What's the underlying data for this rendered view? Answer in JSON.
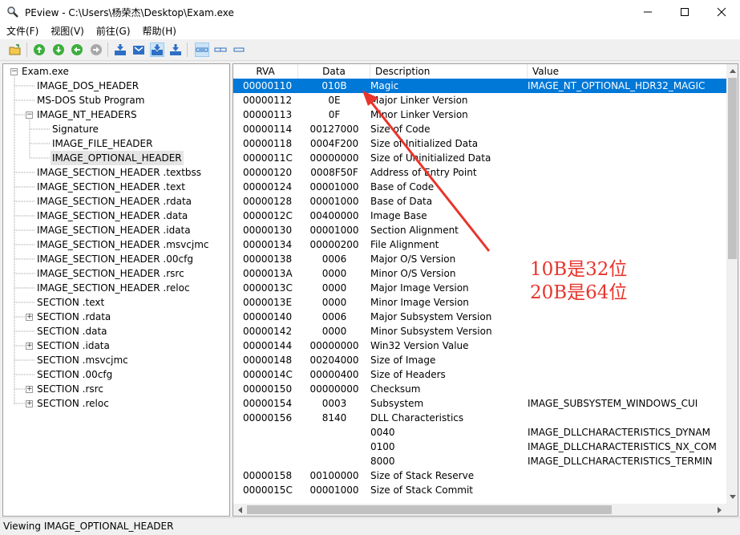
{
  "window": {
    "title": "PEview - C:\\Users\\杨荣杰\\Desktop\\Exam.exe",
    "minimize_glyph": "—",
    "maximize_glyph": "☐",
    "close_glyph": "✕"
  },
  "menu": [
    "文件(F)",
    "视图(V)",
    "前往(G)",
    "帮助(H)"
  ],
  "toolbar": {
    "icons": [
      "open-folder-icon",
      "go-up-icon",
      "go-down-icon",
      "go-back-icon",
      "go-forward-icon",
      "view-byte-icon",
      "view-word-icon",
      "view-dword-icon",
      "view-qword-icon",
      "list-view-icon",
      "column-view-icon",
      "small-view-icon"
    ]
  },
  "tree": {
    "items": [
      {
        "label": "Exam.exe"
      },
      {
        "label": "IMAGE_DOS_HEADER"
      },
      {
        "label": "MS-DOS Stub Program"
      },
      {
        "label": "IMAGE_NT_HEADERS"
      },
      {
        "label": "Signature"
      },
      {
        "label": "IMAGE_FILE_HEADER"
      },
      {
        "label": "IMAGE_OPTIONAL_HEADER"
      },
      {
        "label": "IMAGE_SECTION_HEADER .textbss"
      },
      {
        "label": "IMAGE_SECTION_HEADER .text"
      },
      {
        "label": "IMAGE_SECTION_HEADER .rdata"
      },
      {
        "label": "IMAGE_SECTION_HEADER .data"
      },
      {
        "label": "IMAGE_SECTION_HEADER .idata"
      },
      {
        "label": "IMAGE_SECTION_HEADER .msvcjmc"
      },
      {
        "label": "IMAGE_SECTION_HEADER .00cfg"
      },
      {
        "label": "IMAGE_SECTION_HEADER .rsrc"
      },
      {
        "label": "IMAGE_SECTION_HEADER .reloc"
      },
      {
        "label": "SECTION .text"
      },
      {
        "label": "SECTION .rdata"
      },
      {
        "label": "SECTION .data"
      },
      {
        "label": "SECTION .idata"
      },
      {
        "label": "SECTION .msvcjmc"
      },
      {
        "label": "SECTION .00cfg"
      },
      {
        "label": "SECTION .rsrc"
      },
      {
        "label": "SECTION .reloc"
      }
    ],
    "expander_collapsed": "+",
    "expander_expanded": "−"
  },
  "columns": [
    "RVA",
    "Data",
    "Description",
    "Value"
  ],
  "rows": [
    [
      "00000110",
      "010B",
      "Magic",
      "IMAGE_NT_OPTIONAL_HDR32_MAGIC"
    ],
    [
      "00000112",
      "0E",
      "Major Linker Version",
      ""
    ],
    [
      "00000113",
      "0F",
      "Minor Linker Version",
      ""
    ],
    [
      "00000114",
      "00127000",
      "Size of Code",
      ""
    ],
    [
      "00000118",
      "0004F200",
      "Size of Initialized Data",
      ""
    ],
    [
      "0000011C",
      "00000000",
      "Size of Uninitialized Data",
      ""
    ],
    [
      "00000120",
      "0008F50F",
      "Address of Entry Point",
      ""
    ],
    [
      "00000124",
      "00001000",
      "Base of Code",
      ""
    ],
    [
      "00000128",
      "00001000",
      "Base of Data",
      ""
    ],
    [
      "0000012C",
      "00400000",
      "Image Base",
      ""
    ],
    [
      "00000130",
      "00001000",
      "Section Alignment",
      ""
    ],
    [
      "00000134",
      "00000200",
      "File Alignment",
      ""
    ],
    [
      "00000138",
      "0006",
      "Major O/S Version",
      ""
    ],
    [
      "0000013A",
      "0000",
      "Minor O/S Version",
      ""
    ],
    [
      "0000013C",
      "0000",
      "Major Image Version",
      ""
    ],
    [
      "0000013E",
      "0000",
      "Minor Image Version",
      ""
    ],
    [
      "00000140",
      "0006",
      "Major Subsystem Version",
      ""
    ],
    [
      "00000142",
      "0000",
      "Minor Subsystem Version",
      ""
    ],
    [
      "00000144",
      "00000000",
      "Win32 Version Value",
      ""
    ],
    [
      "00000148",
      "00204000",
      "Size of Image",
      ""
    ],
    [
      "0000014C",
      "00000400",
      "Size of Headers",
      ""
    ],
    [
      "00000150",
      "00000000",
      "Checksum",
      ""
    ],
    [
      "00000154",
      "0003",
      "Subsystem",
      "IMAGE_SUBSYSTEM_WINDOWS_CUI"
    ],
    [
      "00000156",
      "8140",
      "DLL Characteristics",
      ""
    ],
    [
      "",
      "",
      "0040",
      "IMAGE_DLLCHARACTERISTICS_DYNAM"
    ],
    [
      "",
      "",
      "0100",
      "IMAGE_DLLCHARACTERISTICS_NX_COM"
    ],
    [
      "",
      "",
      "8000",
      "IMAGE_DLLCHARACTERISTICS_TERMIN"
    ],
    [
      "00000158",
      "00100000",
      "Size of Stack Reserve",
      ""
    ],
    [
      "0000015C",
      "00001000",
      "Size of Stack Commit",
      ""
    ]
  ],
  "selected_row": 0,
  "annotation": {
    "line1": "10B是32位",
    "line2": "20B是64位",
    "color": "#e8342c"
  },
  "status": "Viewing IMAGE_OPTIONAL_HEADER",
  "colors": {
    "selection": "#0078d7",
    "tree_selection": "#e5e5e5"
  }
}
